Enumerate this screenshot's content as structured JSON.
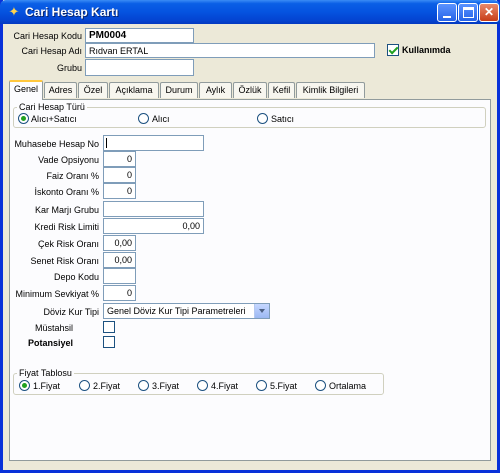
{
  "window": {
    "title": "Cari Hesap Kartı"
  },
  "header": {
    "code_label": "Cari Hesap Kodu",
    "code_value": "PM0004",
    "name_label": "Cari Hesap Adı",
    "name_value": "Rıdvan ERTAL",
    "group_label": "Grubu",
    "group_value": "",
    "active_label": "Kullanımda",
    "active_checked": true
  },
  "tabs": [
    {
      "label": "Genel",
      "active": true
    },
    {
      "label": "Adres"
    },
    {
      "label": "Özel"
    },
    {
      "label": "Açıklama"
    },
    {
      "label": "Durum"
    },
    {
      "label": "Aylık"
    },
    {
      "label": "Özlük"
    },
    {
      "label": "Kefil"
    },
    {
      "label": "Kimlik Bilgileri"
    }
  ],
  "account_type": {
    "title": "Cari Hesap Türü",
    "options": [
      "Alıcı+Satıcı",
      "Alıcı",
      "Satıcı"
    ],
    "selected": "Alıcı+Satıcı"
  },
  "fields": {
    "muhasebe_label": "Muhasebe Hesap No",
    "muhasebe_value": "",
    "vade_label": "Vade Opsiyonu",
    "vade_value": "0",
    "faiz_label": "Faiz Oranı %",
    "faiz_value": "0",
    "iskonto_label": "İskonto Oranı %",
    "iskonto_value": "0",
    "karmarji_label": "Kar Marjı Grubu",
    "karmarji_value": "",
    "kredi_label": "Kredi Risk Limiti",
    "kredi_value": "0,00",
    "cek_label": "Çek Risk Oranı",
    "cek_value": "0,00",
    "senet_label": "Senet Risk Oranı",
    "senet_value": "0,00",
    "depo_label": "Depo Kodu",
    "depo_value": "",
    "sevkiyat_label": "Minimum Sevkiyat %",
    "sevkiyat_value": "0",
    "doviz_label": "Döviz Kur Tipi",
    "doviz_value": "Genel Döviz Kur Tipi Parametreleri",
    "mustahsil_label": "Müstahsil",
    "potansiyel_label": "Potansiyel"
  },
  "price_table": {
    "title": "Fiyat Tablosu",
    "options": [
      "1.Fiyat",
      "2.Fiyat",
      "3.Fiyat",
      "4.Fiyat",
      "5.Fiyat",
      "Ortalama"
    ],
    "selected": "1.Fiyat"
  }
}
